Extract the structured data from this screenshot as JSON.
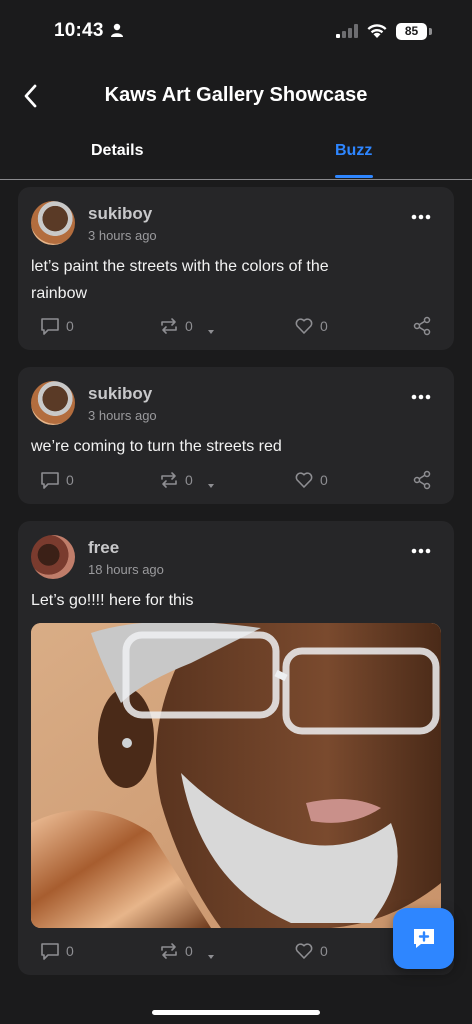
{
  "status_bar": {
    "time": "10:43",
    "battery": "85"
  },
  "header": {
    "title": "Kaws Art Gallery Showcase"
  },
  "tabs": [
    {
      "label": "Details",
      "active": false
    },
    {
      "label": "Buzz",
      "active": true
    }
  ],
  "posts": [
    {
      "username": "sukiboy",
      "timestamp": "3 hours ago",
      "text_line1": "let’s paint the streets with the colors of the",
      "text_line2": "rainbow",
      "comments": "0",
      "reposts": "0",
      "likes": "0"
    },
    {
      "username": "sukiboy",
      "timestamp": "3 hours ago",
      "text_line1": "we’re coming to turn the streets red",
      "comments": "0",
      "reposts": "0",
      "likes": "0"
    },
    {
      "username": "free",
      "timestamp": "18 hours ago",
      "text_line1": "Let’s go!!!! here for this",
      "comments": "0",
      "reposts": "0",
      "likes": "0"
    }
  ],
  "colors": {
    "accent": "#2e86ff",
    "background": "#1b1b1c",
    "card": "#262628"
  }
}
